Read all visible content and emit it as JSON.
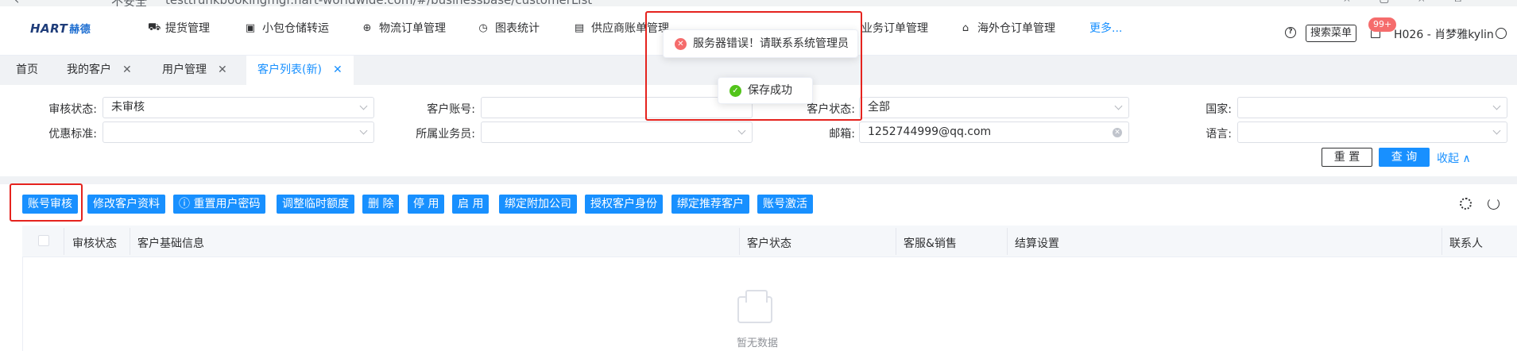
{
  "browser": {
    "insecure_label": "不安全",
    "url": "testtrunkbookingmgr.hart-worldwide.com/#/businessbase/customerList"
  },
  "brand": {
    "logo_en": "HART",
    "logo_cn": "赫德"
  },
  "nav": {
    "items": [
      {
        "label": "提货管理",
        "icon": "car-icon"
      },
      {
        "label": "小包仓储转运",
        "icon": "box-icon"
      },
      {
        "label": "物流订单管理",
        "icon": "globe-icon"
      },
      {
        "label": "图表统计",
        "icon": "clock-icon"
      },
      {
        "label": "供应商账单管理",
        "icon": "wallet-icon"
      },
      {
        "label": "业务订单管理",
        "icon": ""
      },
      {
        "label": "海外仓订单管理",
        "icon": "home-icon"
      }
    ],
    "more": "更多..."
  },
  "header": {
    "search_menu": "搜索菜单",
    "badge": "99+",
    "user": "H026 - 肖梦雅kylin"
  },
  "tabs": [
    {
      "label": "首页",
      "closable": false,
      "active": false
    },
    {
      "label": "我的客户",
      "closable": true,
      "active": false
    },
    {
      "label": "用户管理",
      "closable": true,
      "active": false
    },
    {
      "label": "客户列表(新)",
      "closable": true,
      "active": true
    }
  ],
  "filters": {
    "audit_status": {
      "label": "审核状态:",
      "value": "未审核"
    },
    "discount": {
      "label": "优惠标准:",
      "value": ""
    },
    "account": {
      "label": "客户账号:",
      "value": ""
    },
    "salesman": {
      "label": "所属业务员:",
      "value": ""
    },
    "customer_status": {
      "label": "客户状态:",
      "value": "全部"
    },
    "email": {
      "label": "邮箱:",
      "value": "1252744999@qq.com"
    },
    "country": {
      "label": "国家:",
      "value": ""
    },
    "language": {
      "label": "语言:",
      "value": ""
    },
    "reset": "重 置",
    "query": "查 询",
    "collapse": "收起 ∧"
  },
  "toolbar": {
    "buttons": [
      "账号审核",
      "修改客户资料",
      "ⓘ 重置用户密码",
      "调整临时额度",
      "删 除",
      "停 用",
      "启 用",
      "绑定附加公司",
      "授权客户身份",
      "绑定推荐客户",
      "账号激活"
    ]
  },
  "table": {
    "columns": [
      "审核状态",
      "客户基础信息",
      "客户状态",
      "客服&销售",
      "结算设置",
      "联系人"
    ],
    "empty": "暂无数据"
  },
  "messages": {
    "error": "服务器错误！请联系系统管理员",
    "success": "保存成功"
  },
  "colors": {
    "primary": "#1890ff",
    "danger": "#f56c6c",
    "success": "#52c41a",
    "highlight": "#e5231e"
  }
}
